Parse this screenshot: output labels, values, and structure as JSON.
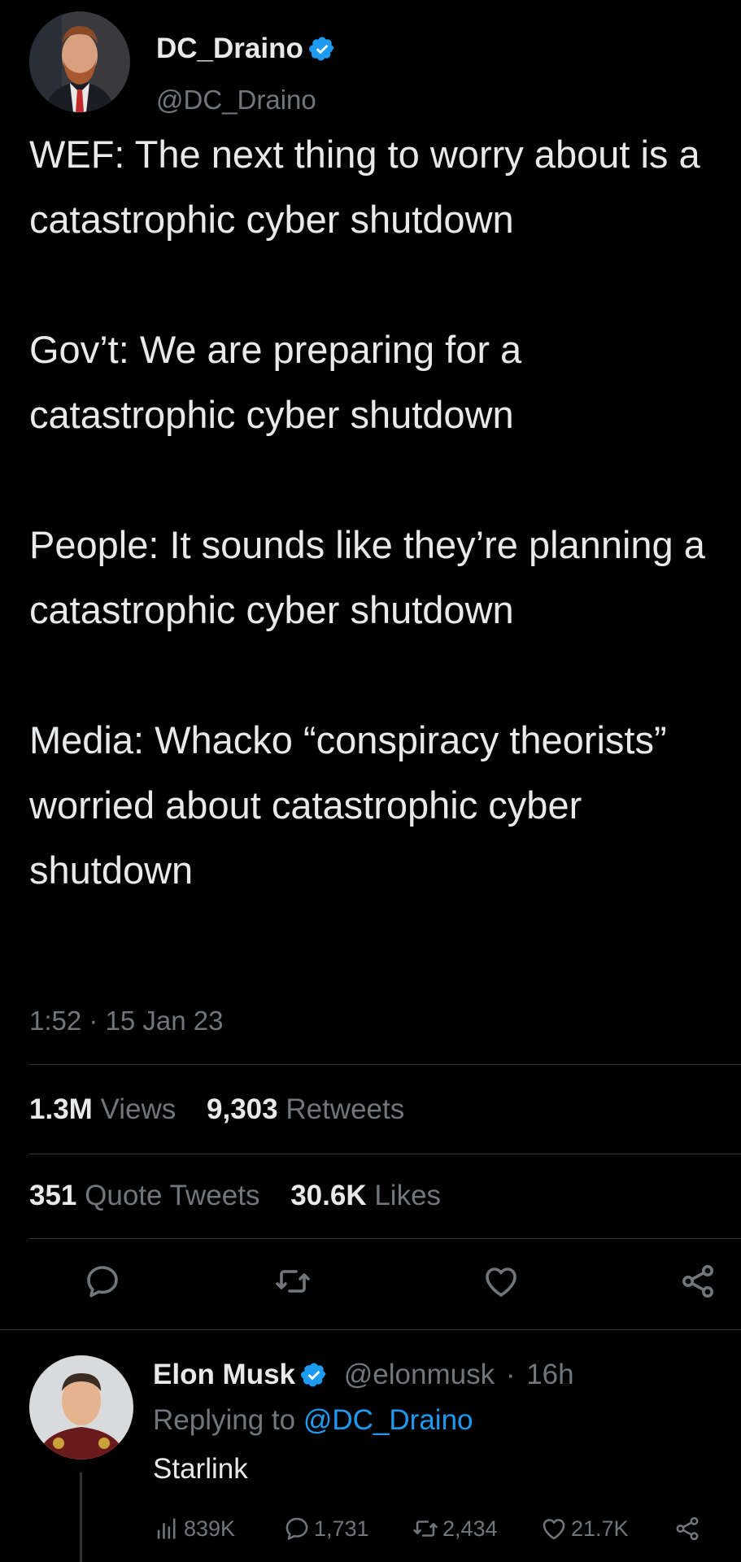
{
  "tweet": {
    "author": {
      "name": "DC_Draino",
      "handle": "@DC_Draino",
      "verified": true
    },
    "paragraphs": [
      "WEF: The next thing to worry about is a catastrophic cyber shutdown",
      "Gov’t: We are preparing for a catastrophic cyber shutdown",
      "People: It sounds like they’re planning a catastrophic cyber shutdown",
      "Media: Whacko “conspiracy theorists” worried about catastrophic cyber shutdown"
    ],
    "timestamp": "1:52 · 15 Jan 23",
    "stats": {
      "views_count": "1.3M",
      "views_label": "Views",
      "retweets_count": "9,303",
      "retweets_label": "Retweets",
      "quotes_count": "351",
      "quotes_label": "Quote Tweets",
      "likes_count": "30.6K",
      "likes_label": "Likes"
    },
    "actions": {
      "reply_icon": "reply-icon",
      "retweet_icon": "retweet-icon",
      "like_icon": "heart-icon",
      "share_icon": "share-icon"
    }
  },
  "reply": {
    "author": {
      "name": "Elon Musk",
      "handle": "@elonmusk",
      "time": "16h",
      "verified": true
    },
    "replying_prefix": "Replying to",
    "replying_to": "@DC_Draino",
    "text": "Starlink",
    "stats": {
      "views": "839K",
      "replies": "1,731",
      "retweets": "2,434",
      "likes": "21.7K"
    }
  },
  "colors": {
    "background": "#000000",
    "text": "#e7e9ea",
    "secondary": "#71767b",
    "accent": "#1d9bf0",
    "divider": "#2f3336"
  }
}
